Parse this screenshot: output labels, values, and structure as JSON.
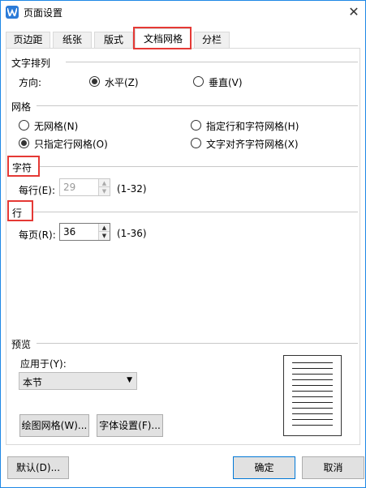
{
  "window": {
    "title": "页面设置"
  },
  "tabs": [
    {
      "label": "页边距"
    },
    {
      "label": "纸张"
    },
    {
      "label": "版式"
    },
    {
      "label": "文档网格"
    },
    {
      "label": "分栏"
    }
  ],
  "text_direction": {
    "group_title": "文字排列",
    "direction_label": "方向:",
    "horizontal_label": "水平(Z)",
    "vertical_label": "垂直(V)",
    "selected": "horizontal"
  },
  "grid": {
    "group_title": "网格",
    "options": [
      {
        "label": "无网格(N)",
        "selected": false
      },
      {
        "label": "指定行和字符网格(H)",
        "selected": false
      },
      {
        "label": "只指定行网格(O)",
        "selected": true
      },
      {
        "label": "文字对齐字符网格(X)",
        "selected": false
      }
    ]
  },
  "characters": {
    "group_title": "字符",
    "per_line_label": "每行(E):",
    "per_line_value": "29",
    "range": "(1-32)"
  },
  "lines": {
    "group_title": "行",
    "per_page_label": "每页(R):",
    "per_page_value": "36",
    "range": "(1-36)"
  },
  "preview": {
    "group_title": "预览",
    "apply_to_label": "应用于(Y):",
    "apply_to_value": "本节",
    "draw_grid_button": "绘图网格(W)...",
    "font_settings_button": "字体设置(F)..."
  },
  "footer": {
    "default_button": "默认(D)...",
    "ok_button": "确定",
    "cancel_button": "取消"
  },
  "colors": {
    "highlight": "#e53935",
    "accent": "#0078d7"
  }
}
